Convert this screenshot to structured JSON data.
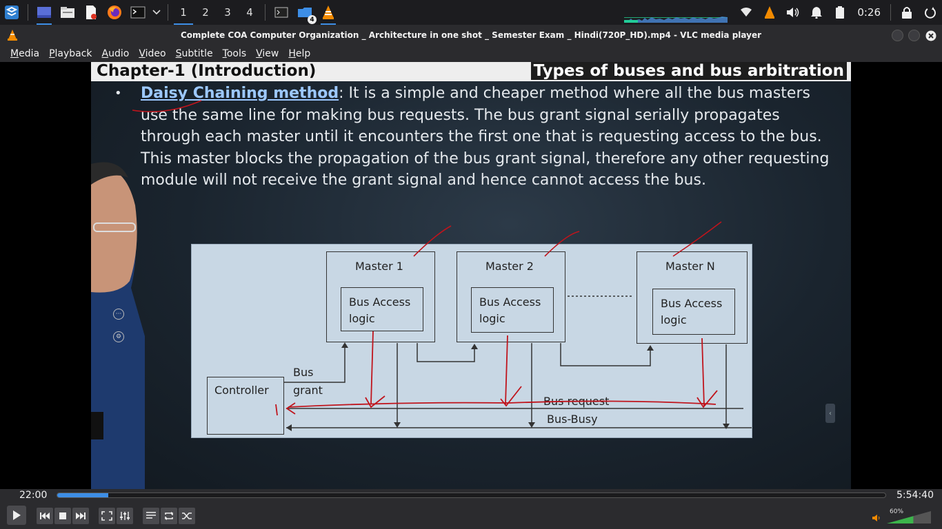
{
  "taskbar": {
    "workspaces": [
      "1",
      "2",
      "3",
      "4"
    ],
    "task_badge": "4",
    "clock": "0:26"
  },
  "window": {
    "title": "Complete COA Computer Organization _ Architecture in one shot _ Semester Exam _ Hindi(720P_HD).mp4 - VLC media player"
  },
  "menu": {
    "items": [
      "Media",
      "Playback",
      "Audio",
      "Video",
      "Subtitle",
      "Tools",
      "View",
      "Help"
    ]
  },
  "slide": {
    "chapter": "Chapter-1 (Introduction)",
    "topic": "Types of buses and bus arbitration",
    "bullet": "•",
    "term": "Daisy Chaining method",
    "paragraph": ": It is a simple and cheaper method where all the bus masters use the same line for making bus requests. The bus grant signal serially propagates through each master until it encounters the first one that is requesting access to the bus. This master blocks the propagation of the bus grant signal, therefore any other requesting module will not receive the grant signal and hence cannot access the bus.",
    "diagram": {
      "master1": "Master 1",
      "master2": "Master 2",
      "masterN": "Master N",
      "logic": "Bus Access logic",
      "controller": "Controller",
      "bus_grant_1": "Bus",
      "bus_grant_2": "grant",
      "bus_request": "Bus request",
      "bus_busy": "Bus-Busy"
    }
  },
  "player": {
    "elapsed": "22:00",
    "total": "5:54:40",
    "progress_fraction": 0.062,
    "volume": "60%",
    "volume_fraction": 0.6
  },
  "colors": {
    "accent": "#3d8ee6",
    "vlc_orange": "#f28a00",
    "annotation_red": "#c0141c"
  }
}
